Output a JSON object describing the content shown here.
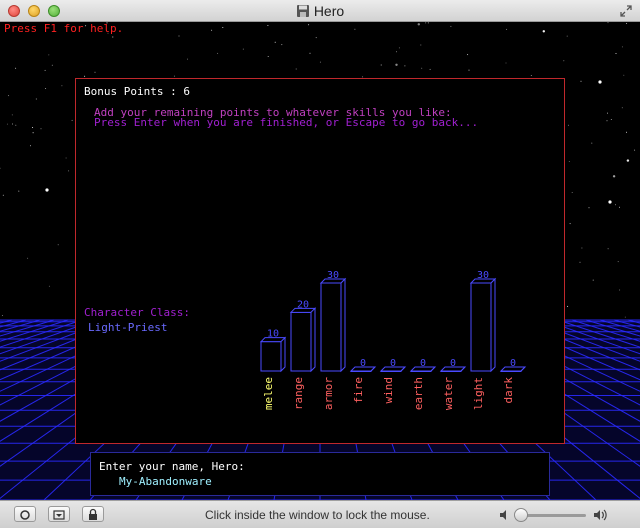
{
  "window": {
    "title": "Hero"
  },
  "game": {
    "help_text": "Press F1 for help.",
    "bonus_label": "Bonus Points : 6",
    "instruction_1": "Add your remaining points to whatever skills you like:",
    "instruction_2": "Press Enter when you are finished, or Escape to go back...",
    "class_label": "Character Class:",
    "class_value": "Light-Priest",
    "name_prompt": "Enter your name, Hero:",
    "name_value": "My-Abandonware",
    "colors": {
      "yellow": "#ffff70",
      "pink": "#ff6060",
      "blue": "#4a4aff",
      "purple": "#c040c0",
      "magenta": "#a020d0",
      "cyan": "#9ff0ff",
      "red_border": "#c0282c"
    }
  },
  "chart_data": {
    "type": "bar",
    "categories": [
      "melee",
      "range",
      "armor",
      "fire",
      "wind",
      "earth",
      "water",
      "light",
      "dark"
    ],
    "values": [
      10,
      20,
      30,
      0,
      0,
      0,
      0,
      30,
      0
    ],
    "value_labels": [
      "10",
      "20",
      "30",
      "0",
      "0",
      "0",
      "0",
      "30",
      "0"
    ],
    "selected_index": 0
  },
  "statusbar": {
    "text": "Click inside the window to lock the mouse."
  }
}
